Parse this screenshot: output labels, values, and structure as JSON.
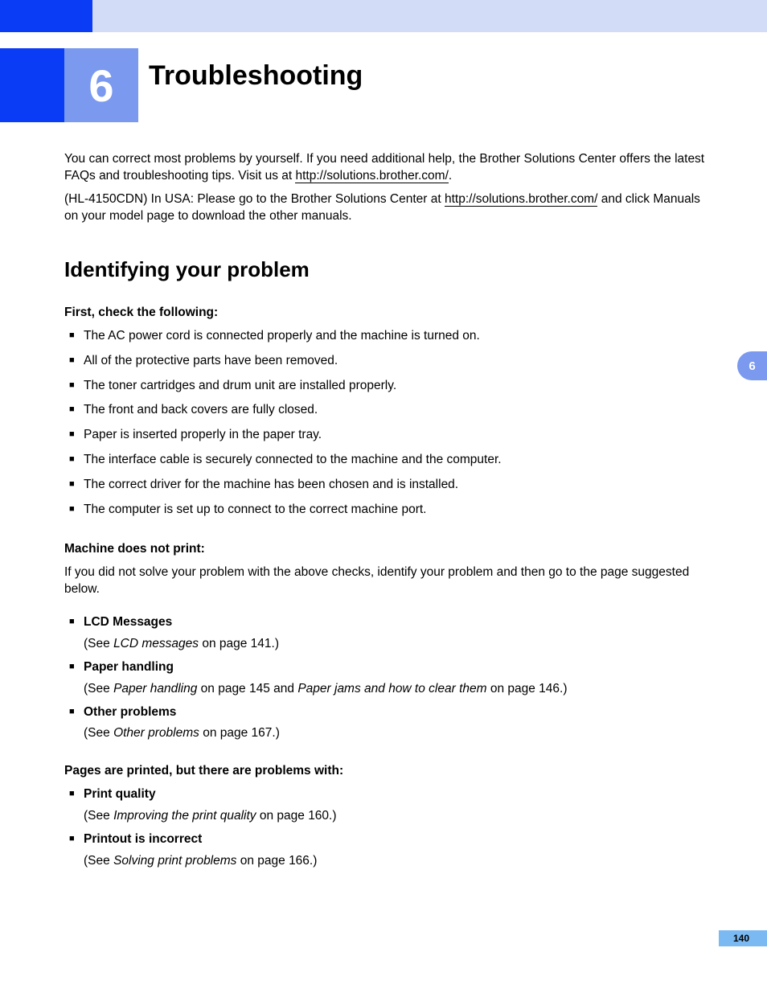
{
  "chapter": {
    "number": "6",
    "title": "Troubleshooting"
  },
  "sideTab": "6",
  "pageNumber": "140",
  "intro": {
    "p1a": "You can correct most problems by yourself. If you need additional help, the Brother Solutions Center offers the latest FAQs and troubleshooting tips. Visit us at ",
    "link1": "http://solutions.brother.com/",
    "p1b": ".",
    "p2a": "(HL-4150CDN) In USA:  Please go to the Brother Solutions Center at ",
    "link2": "http://solutions.brother.com/",
    "p2b": " and click Manuals on your model page to download the other manuals."
  },
  "section": {
    "title": "Identifying your problem",
    "sub1": "First, check the following:",
    "checks": [
      "The AC power cord is connected properly and the machine is turned on.",
      "All of the protective parts have been removed.",
      "The toner cartridges and drum unit are installed properly.",
      "The front and back covers are fully closed.",
      "Paper is inserted properly in the paper tray.",
      "The interface cable is securely connected to the machine and the computer.",
      "The correct driver for the machine has been chosen and is installed.",
      "The computer is set up to connect to the correct machine port."
    ],
    "sub2": "Machine does not print:",
    "sub2text": "If you did not solve your problem with the above checks, identify your problem and then go to the page suggested below.",
    "lcd": {
      "title": "LCD Messages",
      "see_a": "(See ",
      "see_i": "LCD messages",
      "see_b": " on page 141.)"
    },
    "paper": {
      "title": "Paper handling",
      "see_a": "(See ",
      "see_i1": "Paper handling",
      "see_mid": " on page 145 and ",
      "see_i2": "Paper jams and how to clear them",
      "see_b": " on page 146.)"
    },
    "other": {
      "title": "Other problems",
      "see_a": "(See ",
      "see_i": "Other problems",
      "see_b": " on page 167.)"
    },
    "sub3": "Pages are printed, but there are problems with:",
    "quality": {
      "title": "Print quality",
      "see_a": "(See ",
      "see_i": "Improving the print quality",
      "see_b": " on page 160.)"
    },
    "incorrect": {
      "title": "Printout is incorrect",
      "see_a": "(See ",
      "see_i": "Solving print problems",
      "see_b": " on page 166.)"
    }
  }
}
